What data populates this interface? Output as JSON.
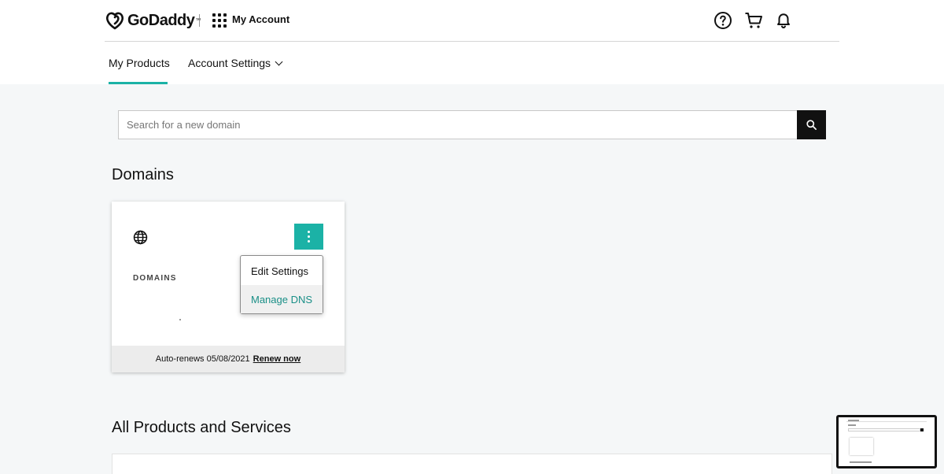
{
  "header": {
    "brand": "GoDaddy",
    "brand_tm": "™",
    "account_label": "My Account",
    "icons": [
      "help-icon",
      "cart-icon",
      "bell-icon"
    ]
  },
  "nav": {
    "tabs": [
      {
        "label": "My Products",
        "active": true
      },
      {
        "label": "Account Settings",
        "active": false,
        "has_dropdown": true
      }
    ]
  },
  "search": {
    "placeholder": "Search for a new domain",
    "value": ""
  },
  "domains_section": {
    "title": "Domains",
    "card": {
      "icon": "globe-icon",
      "label": "DOMAINS",
      "footer_text": "Auto-renews 05/08/2021",
      "renew_link": "Renew now"
    },
    "menu": {
      "items": [
        "Edit Settings",
        "Manage DNS"
      ],
      "hovered": "Manage DNS"
    }
  },
  "products_section": {
    "title": "All Products and Services"
  },
  "colors": {
    "accent": "#1bb2a6",
    "background": "#f5f7f8",
    "button_dark": "#111111"
  }
}
